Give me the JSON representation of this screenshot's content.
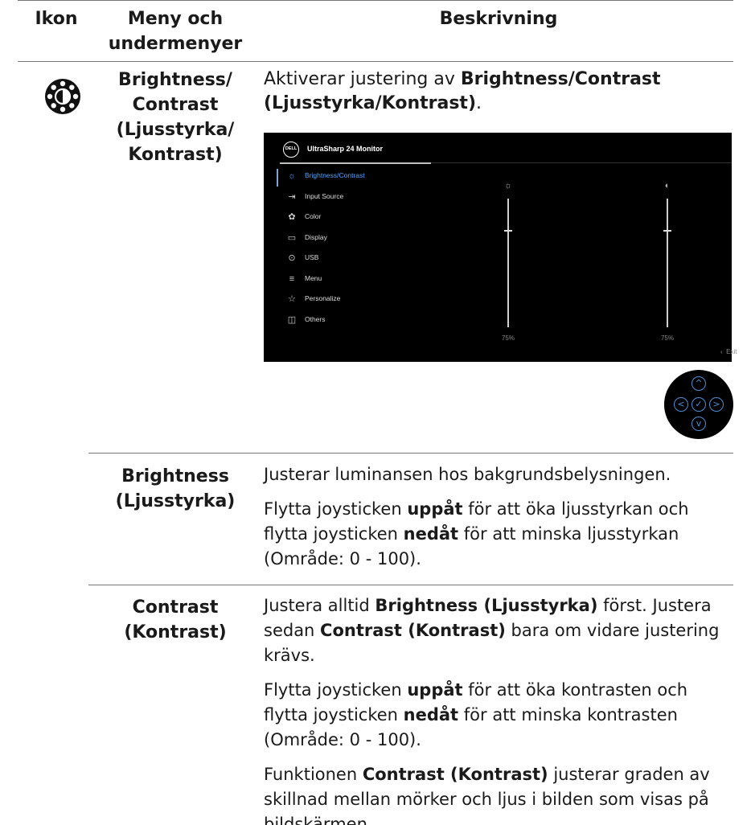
{
  "headers": {
    "icon": "Ikon",
    "menu": "Meny och\nundermenyer",
    "desc": "Beskrivning"
  },
  "main_row": {
    "icon": "brightness-contrast-icon",
    "menu_name": "Brightness/\nContrast\n(Ljusstyrka/\nKontrast)",
    "desc_pre": "Aktiverar justering av ",
    "desc_bold": "Brightness/Contrast (Ljusstyrka/Kontrast)",
    "desc_post": "."
  },
  "osd": {
    "logo": "DELL",
    "title": "UltraSharp 24 Monitor",
    "menu_items": [
      {
        "label": "Brightness/Contrast",
        "icon": "sun-icon",
        "active": true
      },
      {
        "label": "Input Source",
        "icon": "input-icon",
        "active": false
      },
      {
        "label": "Color",
        "icon": "palette-icon",
        "active": false
      },
      {
        "label": "Display",
        "icon": "monitor-icon",
        "active": false
      },
      {
        "label": "USB",
        "icon": "usb-icon",
        "active": false
      },
      {
        "label": "Menu",
        "icon": "menu-icon",
        "active": false
      },
      {
        "label": "Personalize",
        "icon": "star-icon",
        "active": false
      },
      {
        "label": "Others",
        "icon": "others-icon",
        "active": false
      }
    ],
    "brightness_value": "75%",
    "contrast_value": "75%",
    "brightness_level": 75,
    "contrast_level": 75,
    "exit_label": "Exit"
  },
  "rows": [
    {
      "menu_name": "Brightness\n(Ljusstyrka)",
      "paragraphs": [
        [
          {
            "t": "Justerar luminansen hos bakgrundsbelysningen."
          }
        ],
        [
          {
            "t": "Flytta joysticken "
          },
          {
            "t": "uppåt",
            "b": true
          },
          {
            "t": " för att öka ljusstyrkan och flytta joysticken "
          },
          {
            "t": "nedåt",
            "b": true
          },
          {
            "t": " för att minska ljusstyrkan (Område: 0 - 100)."
          }
        ]
      ]
    },
    {
      "menu_name": "Contrast\n(Kontrast)",
      "paragraphs": [
        [
          {
            "t": "Justera alltid "
          },
          {
            "t": "Brightness (Ljusstyrka)",
            "b": true
          },
          {
            "t": " först. Justera sedan "
          },
          {
            "t": "Contrast (Kontrast)",
            "b": true
          },
          {
            "t": " bara om vidare justering krävs."
          }
        ],
        [
          {
            "t": "Flytta joysticken "
          },
          {
            "t": "uppåt",
            "b": true
          },
          {
            "t": " för att öka kontrasten och flytta joysticken "
          },
          {
            "t": "nedåt",
            "b": true
          },
          {
            "t": " för att minska kontrasten (Område: 0 - 100)."
          }
        ],
        [
          {
            "t": "Funktionen "
          },
          {
            "t": "Contrast (Kontrast)",
            "b": true
          },
          {
            "t": " justerar graden av skillnad mellan mörker och ljus i bilden som visas på bildskärmen."
          }
        ]
      ]
    }
  ],
  "joystick": {
    "up": "^",
    "down": "v",
    "left": "<",
    "right": ">",
    "center": "✓"
  }
}
